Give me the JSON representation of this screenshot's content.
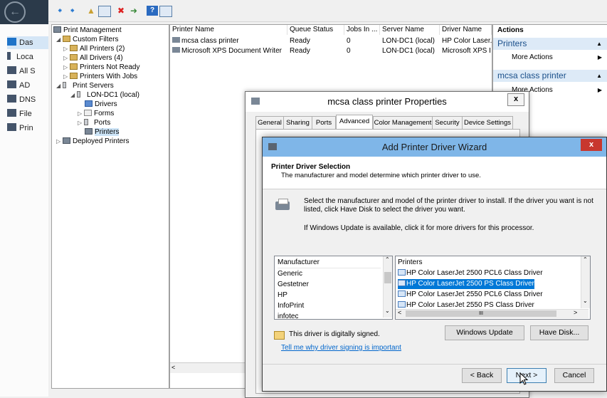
{
  "server_manager": {
    "nav": [
      {
        "label": "Das",
        "icon": "dashboard-icon",
        "selected": true
      },
      {
        "label": "Loca",
        "icon": "server-icon"
      },
      {
        "label": "All S",
        "icon": "servers-icon"
      },
      {
        "label": "AD",
        "icon": "ad-icon"
      },
      {
        "label": "DNS",
        "icon": "dns-icon"
      },
      {
        "label": "File",
        "icon": "file-services-icon"
      },
      {
        "label": "Prin",
        "icon": "print-services-icon"
      }
    ]
  },
  "toolbar": {
    "icons": [
      "back-arrow-icon",
      "forward-arrow-icon",
      "up-folder-icon",
      "show-hide-tree-icon",
      "delete-icon",
      "export-icon",
      "help-icon",
      "properties-icon"
    ]
  },
  "tree": {
    "root": "Print Management",
    "custom_filters": "Custom Filters",
    "all_printers": "All Printers (2)",
    "all_drivers": "All Drivers (4)",
    "printers_not_ready": "Printers Not Ready",
    "printers_with_jobs": "Printers With Jobs",
    "print_servers": "Print Servers",
    "server": "LON-DC1 (local)",
    "drivers": "Drivers",
    "forms": "Forms",
    "ports": "Ports",
    "printers": "Printers",
    "deployed": "Deployed Printers"
  },
  "list": {
    "columns": [
      "Printer Name",
      "Queue Status",
      "Jobs In ...",
      "Server Name",
      "Driver Name"
    ],
    "rows": [
      [
        "mcsa class printer",
        "Ready",
        "0",
        "LON-DC1 (local)",
        "HP Color Laser."
      ],
      [
        "Microsoft XPS Document Writer",
        "Ready",
        "0",
        "LON-DC1 (local)",
        "Microsoft XPS I"
      ]
    ]
  },
  "actions": {
    "header": "Actions",
    "sections": [
      {
        "title": "Printers",
        "item": "More Actions"
      },
      {
        "title": "mcsa class printer",
        "item": "More Actions"
      }
    ]
  },
  "props": {
    "title": "mcsa class printer Properties",
    "close": "x",
    "tabs": [
      "General",
      "Sharing",
      "Ports",
      "Advanced",
      "Color Management",
      "Security",
      "Device Settings"
    ],
    "active_tab": "Advanced"
  },
  "wizard": {
    "title": "Add Printer Driver Wizard",
    "close": "x",
    "heading": "Printer Driver Selection",
    "subheading": "The manufacturer and model determine which printer driver to use.",
    "instruction": "Select the manufacturer and model of the printer driver to install. If the driver you want is not listed, click Have Disk to select the driver you want.",
    "windows_update_note": "If Windows Update is available, click it for more drivers for this processor.",
    "manufacturer_header": "Manufacturer",
    "manufacturers": [
      "Generic",
      "Gestetner",
      "HP",
      "InfoPrint",
      "infotec"
    ],
    "selected_manufacturer": "HP",
    "printers_header": "Printers",
    "printers": [
      "HP Color LaserJet 2500 PCL6 Class Driver",
      "HP Color LaserJet 2500 PS Class Driver",
      "HP Color LaserJet 2550 PCL6 Class Driver",
      "HP Color LaserJet 2550 PS Class Driver"
    ],
    "selected_printer": "HP Color LaserJet 2500 PS Class Driver",
    "hscroll_thumb": "III",
    "signed_note": "This driver is digitally signed.",
    "signing_link": "Tell me why driver signing is important",
    "windows_update_button": "Windows Update",
    "have_disk_button": "Have Disk...",
    "back_button": "< Back",
    "next_button": "Next >",
    "cancel_button": "Cancel"
  }
}
